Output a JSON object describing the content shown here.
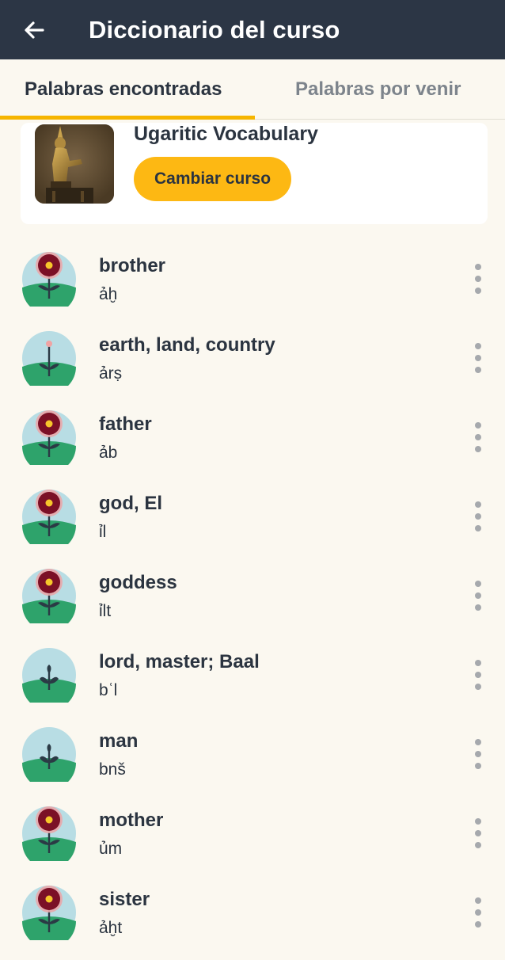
{
  "appbar": {
    "title": "Diccionario del curso",
    "back_icon": "arrow-left-icon"
  },
  "tabs": [
    {
      "label": "Palabras encontradas",
      "active": true
    },
    {
      "label": "Palabras por venir",
      "active": false
    }
  ],
  "course": {
    "name": "Ugaritic Vocabulary",
    "change_label": "Cambiar curso"
  },
  "colors": {
    "appbar": "#2c3645",
    "accent": "#fdb813",
    "background": "#fbf8f0"
  },
  "words": [
    {
      "english": "brother",
      "ugaritic": "ảḫ",
      "icon": "flower-bloom-icon"
    },
    {
      "english": "earth, land, country",
      "ugaritic": "ảrṣ",
      "icon": "flower-bud-icon"
    },
    {
      "english": "father",
      "ugaritic": "ảb",
      "icon": "flower-bloom-icon"
    },
    {
      "english": "god, El",
      "ugaritic": "ỉl",
      "icon": "flower-bloom-icon"
    },
    {
      "english": "goddess",
      "ugaritic": "ỉlt",
      "icon": "flower-bloom-icon"
    },
    {
      "english": "lord, master; Baal",
      "ugaritic": "bʿl",
      "icon": "sprout-icon"
    },
    {
      "english": "man",
      "ugaritic": "bnš",
      "icon": "sprout-icon"
    },
    {
      "english": "mother",
      "ugaritic": "ủm",
      "icon": "flower-bloom-icon"
    },
    {
      "english": "sister",
      "ugaritic": "ảḫt",
      "icon": "flower-bloom-icon"
    }
  ]
}
